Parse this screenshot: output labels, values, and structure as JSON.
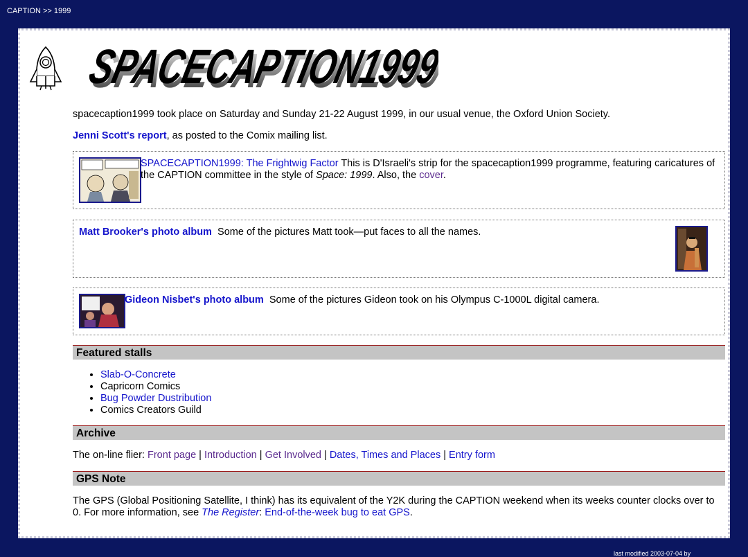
{
  "breadcrumb": "CAPTION >> 1999",
  "logo_text": "SPACECAPTION1999",
  "intro": "spacecaption1999 took place on Saturday and Sunday 21-22 August 1999, in our usual venue, the Oxford Union Society.",
  "report": {
    "link": "Jenni Scott's report",
    "text": ", as posted to the Comix mailing list."
  },
  "strip": {
    "link": "SPACECAPTION1999: The Frightwig Factor",
    "text1": " This is D'Israeli's strip for the spacecaption1999 programme, featuring caricatures of the CAPTION committee in the style of ",
    "italic": "Space: 1999",
    "text2": ". Also, the ",
    "cover_link": "cover",
    "text3": "."
  },
  "matt": {
    "link": "Matt Brooker's photo album",
    "text": "Some of the pictures Matt took—put faces to all the names."
  },
  "gideon": {
    "link": "Gideon Nisbet's photo album",
    "text": "Some of the pictures Gideon took on his Olympus C-1000L digital camera."
  },
  "featured": {
    "heading": "Featured stalls",
    "items": [
      {
        "label": "Slab-O-Concrete"
      },
      {
        "label": "Capricorn Comics"
      },
      {
        "label": "Bug Powder Dustribution"
      },
      {
        "label": "Comics Creators Guild"
      }
    ]
  },
  "archive": {
    "heading": "Archive",
    "prefix": "The on-line flier: ",
    "links": [
      "Front page",
      "Introduction",
      "Get Involved",
      "Dates, Times and Places",
      "Entry form"
    ],
    "sep": " | "
  },
  "gps": {
    "heading": "GPS Note",
    "text1": "The GPS (Global Positioning Satellite, I think) has its equivalent of the Y2K during the CAPTION weekend when its weeks counter clocks over to 0. For more information, see ",
    "register": "The Register",
    "text2": ": ",
    "bug_link": "End-of-the-week bug to eat GPS",
    "text3": "."
  },
  "footer": "last modified 2003-07-04 by"
}
